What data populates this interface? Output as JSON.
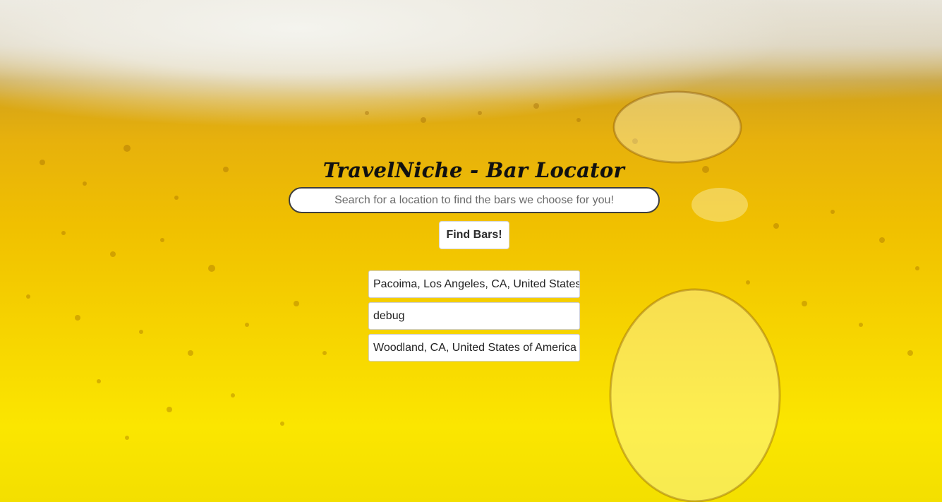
{
  "page": {
    "title": "TravelNiche - Bar Locator"
  },
  "search": {
    "placeholder": "Search for a location to find the bars we choose for you!",
    "value": ""
  },
  "actions": {
    "find_label": "Find Bars!"
  },
  "history": {
    "items": [
      "Pacoima, Los Angeles, CA, United States of America",
      "debug",
      "Woodland, CA, United States of America"
    ]
  },
  "theme": {
    "background": "beer-bubbles",
    "accent": "#f2c400",
    "text": "#111111"
  }
}
